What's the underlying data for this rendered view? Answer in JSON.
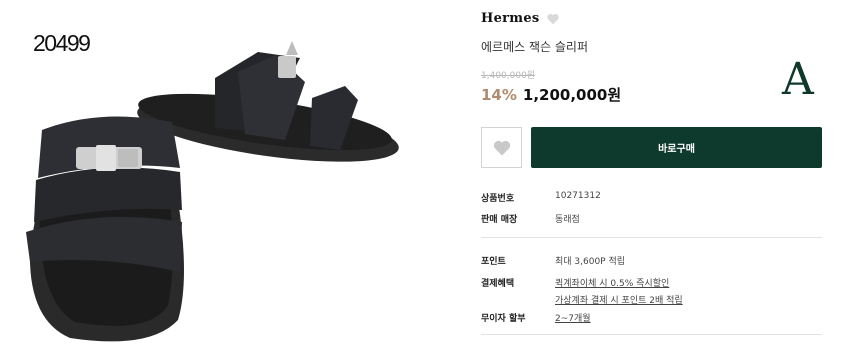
{
  "image": {
    "sku_overlay": "20499"
  },
  "product": {
    "brand": "Hermes",
    "name": "에르메스 잭슨 슬리퍼",
    "original_price": "1,400,000원",
    "discount": "14%",
    "price": "1,200,000원",
    "grade": "A"
  },
  "actions": {
    "buy_label": "바로구매"
  },
  "details": {
    "product_no_label": "상품번호",
    "product_no_value": "10271312",
    "store_label": "판매 매장",
    "store_value": "동래점",
    "points_label": "포인트",
    "points_value": "최대 3,600P 적립",
    "benefits_label": "결제혜택",
    "benefit_1": "퀵계좌이체 시 0.5% 즉시할인",
    "benefit_2": "가상계좌 결제 시 포인트 2배 적립",
    "installment_label": "무이자 할부",
    "installment_value": "2~7개월"
  },
  "colors": {
    "accent": "#0d3a2c",
    "discount": "#b08b6e"
  }
}
